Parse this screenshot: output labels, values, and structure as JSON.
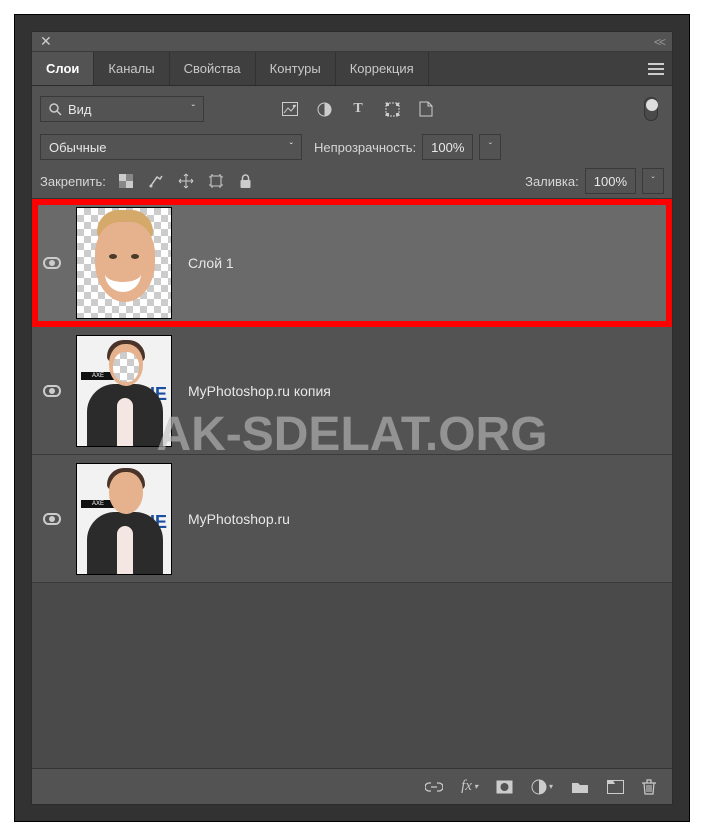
{
  "ui": {
    "tabs": [
      "Слои",
      "Каналы",
      "Свойства",
      "Контуры",
      "Коррекция"
    ],
    "activeTabIndex": 0,
    "filterKind": "Вид",
    "blendMode": "Обычные",
    "opacityLabel": "Непрозрачность:",
    "opacityValue": "100%",
    "lockLabel": "Закрепить:",
    "fillLabel": "Заливка:",
    "fillValue": "100%"
  },
  "layers": [
    {
      "name": "Слой 1",
      "visible": true,
      "selected": true,
      "thumb": "cutout-face"
    },
    {
      "name": "MyPhotoshop.ru копия",
      "visible": true,
      "selected": false,
      "thumb": "person-missing-face"
    },
    {
      "name": "MyPhotoshop.ru",
      "visible": true,
      "selected": false,
      "thumb": "person-full"
    }
  ],
  "watermark": "AK-SDELAT.ORG"
}
